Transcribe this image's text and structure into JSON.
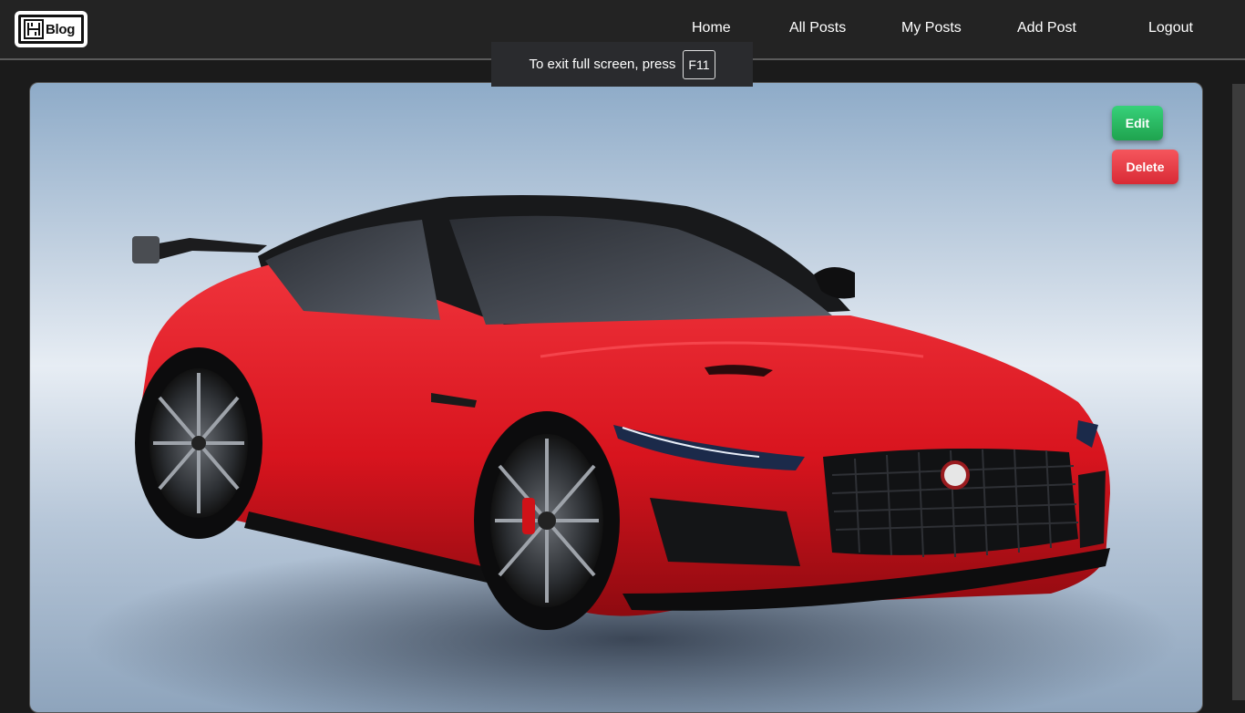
{
  "logo": {
    "text": "Blog",
    "mark_icon": "maze-icon"
  },
  "nav": {
    "items": [
      {
        "label": "Home"
      },
      {
        "label": "All Posts"
      },
      {
        "label": "My Posts"
      },
      {
        "label": "Add Post"
      },
      {
        "label": "Logout"
      }
    ]
  },
  "fullscreen_toast": {
    "message": "To exit full screen, press",
    "key": "F11"
  },
  "post": {
    "image_subject": "red sports car",
    "actions": {
      "edit_label": "Edit",
      "delete_label": "Delete"
    }
  },
  "colors": {
    "navbar_bg": "#232323",
    "page_bg": "#1b1b1b",
    "edit_green": "#1fa34e",
    "delete_red": "#d92a35",
    "car_red": "#d8141e"
  }
}
